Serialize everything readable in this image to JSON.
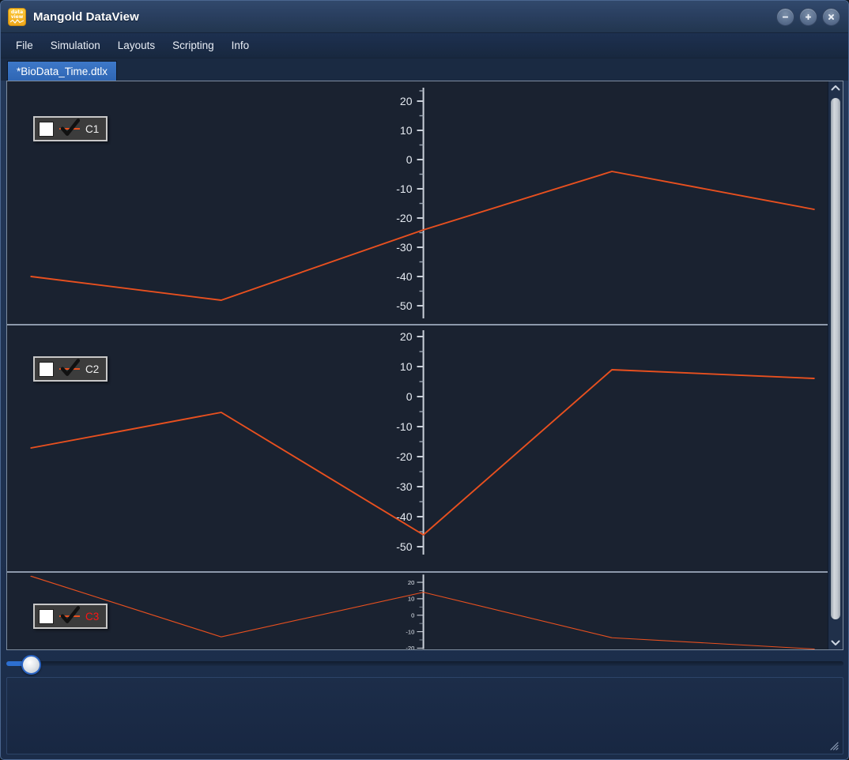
{
  "window": {
    "title": "Mangold DataView",
    "app_icon_top": "data",
    "app_icon_bottom": "view",
    "controls": [
      {
        "name": "minimize-button",
        "glyph": "minus"
      },
      {
        "name": "maximize-button",
        "glyph": "plus"
      },
      {
        "name": "close-button",
        "glyph": "cross"
      }
    ]
  },
  "menubar": {
    "items": [
      {
        "label": "File"
      },
      {
        "label": "Simulation"
      },
      {
        "label": "Layouts"
      },
      {
        "label": "Scripting"
      },
      {
        "label": "Info"
      }
    ]
  },
  "tabs": [
    {
      "label": "*BioData_Time.dtlx",
      "active": true,
      "modified": true
    }
  ],
  "colors": {
    "series_line": "#e8501f",
    "accent_label": "#ff1414",
    "tab_active": "#2f66b4",
    "panel_bg": "#1a2230",
    "axis": "#c9cfd8",
    "slider_fill": "#2d6fd0"
  },
  "scrollbar": {
    "up_arrow": "chevron-up-icon",
    "down_arrow": "chevron-down-icon",
    "orientation": "vertical"
  },
  "slider": {
    "value": 0,
    "min": 0,
    "max": 100
  },
  "statusbar": {
    "text": "",
    "grip": "resize-grip-icon"
  },
  "chart_data": [
    {
      "type": "line",
      "title": "C1",
      "legend": {
        "label": "C1",
        "checked": true,
        "position": "top-left",
        "label_color": "#f0f0f0"
      },
      "xlabel": "",
      "ylabel": "",
      "ylim": [
        -55,
        24
      ],
      "yticks": [
        20,
        10,
        0,
        -10,
        -20,
        -30,
        -40,
        -50
      ],
      "ytick_labels": [
        "20",
        "10",
        "0",
        "-10",
        "-20",
        "-30",
        "-40",
        "-50"
      ],
      "minor_ticks": true,
      "grid": false,
      "axis_position": "center",
      "x": [
        0.0,
        0.26,
        0.51,
        0.73,
        1.0
      ],
      "values": [
        -40,
        -48,
        -24,
        -4,
        -17
      ],
      "series": [
        {
          "name": "C1",
          "color": "#e8501f",
          "values": [
            -40,
            -48,
            -24,
            -4,
            -17
          ]
        }
      ]
    },
    {
      "type": "line",
      "title": "C2",
      "legend": {
        "label": "C2",
        "checked": true,
        "position": "top-left",
        "label_color": "#f0f0f0"
      },
      "xlabel": "",
      "ylabel": "",
      "ylim": [
        -55,
        24
      ],
      "yticks": [
        20,
        10,
        0,
        -10,
        -20,
        -30,
        -40,
        -50
      ],
      "ytick_labels": [
        "20",
        "10",
        "0",
        "-10",
        "-20",
        "-30",
        "-40",
        "-50"
      ],
      "minor_ticks": true,
      "grid": false,
      "axis_position": "center",
      "x": [
        0.0,
        0.26,
        0.51,
        0.73,
        1.0
      ],
      "values": [
        -17,
        -5,
        -46,
        9,
        6
      ],
      "series": [
        {
          "name": "C2",
          "color": "#e8501f",
          "values": [
            -17,
            -5,
            -46,
            9,
            6
          ]
        }
      ]
    },
    {
      "type": "line",
      "title": "C3",
      "legend": {
        "label": "C3",
        "checked": true,
        "position": "top-left",
        "label_color": "#ff1414"
      },
      "xlabel": "",
      "ylabel": "",
      "ylim": [
        -26,
        24
      ],
      "yticks": [
        20,
        10,
        0,
        -10,
        -20
      ],
      "ytick_labels": [
        "20",
        "10",
        "0",
        "-10",
        "-20"
      ],
      "minor_ticks": true,
      "grid": false,
      "axis_position": "center",
      "x": [
        0.0,
        0.26,
        0.51,
        0.73,
        1.0
      ],
      "values": [
        24,
        -13,
        14,
        -14,
        -20
      ],
      "series": [
        {
          "name": "C3",
          "color": "#e8501f",
          "values": [
            24,
            -13,
            14,
            -14,
            -20
          ]
        }
      ]
    }
  ]
}
